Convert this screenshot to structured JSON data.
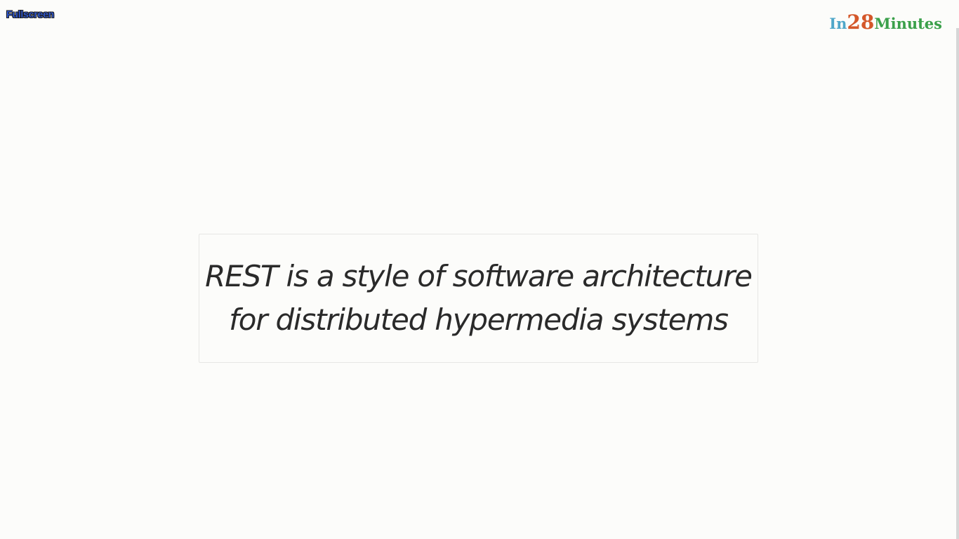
{
  "toolbar": {
    "fullscreen_label": "Fullscreen"
  },
  "brand": {
    "in": "In",
    "number": "28",
    "minutes": "Minutes",
    "colors": {
      "in": "#4fa7c9",
      "number": "#d4572a",
      "minutes": "#3aa04a"
    }
  },
  "slide": {
    "quote_lines": [
      "REST is a style of software architecture",
      "for distributed hypermedia systems"
    ]
  }
}
